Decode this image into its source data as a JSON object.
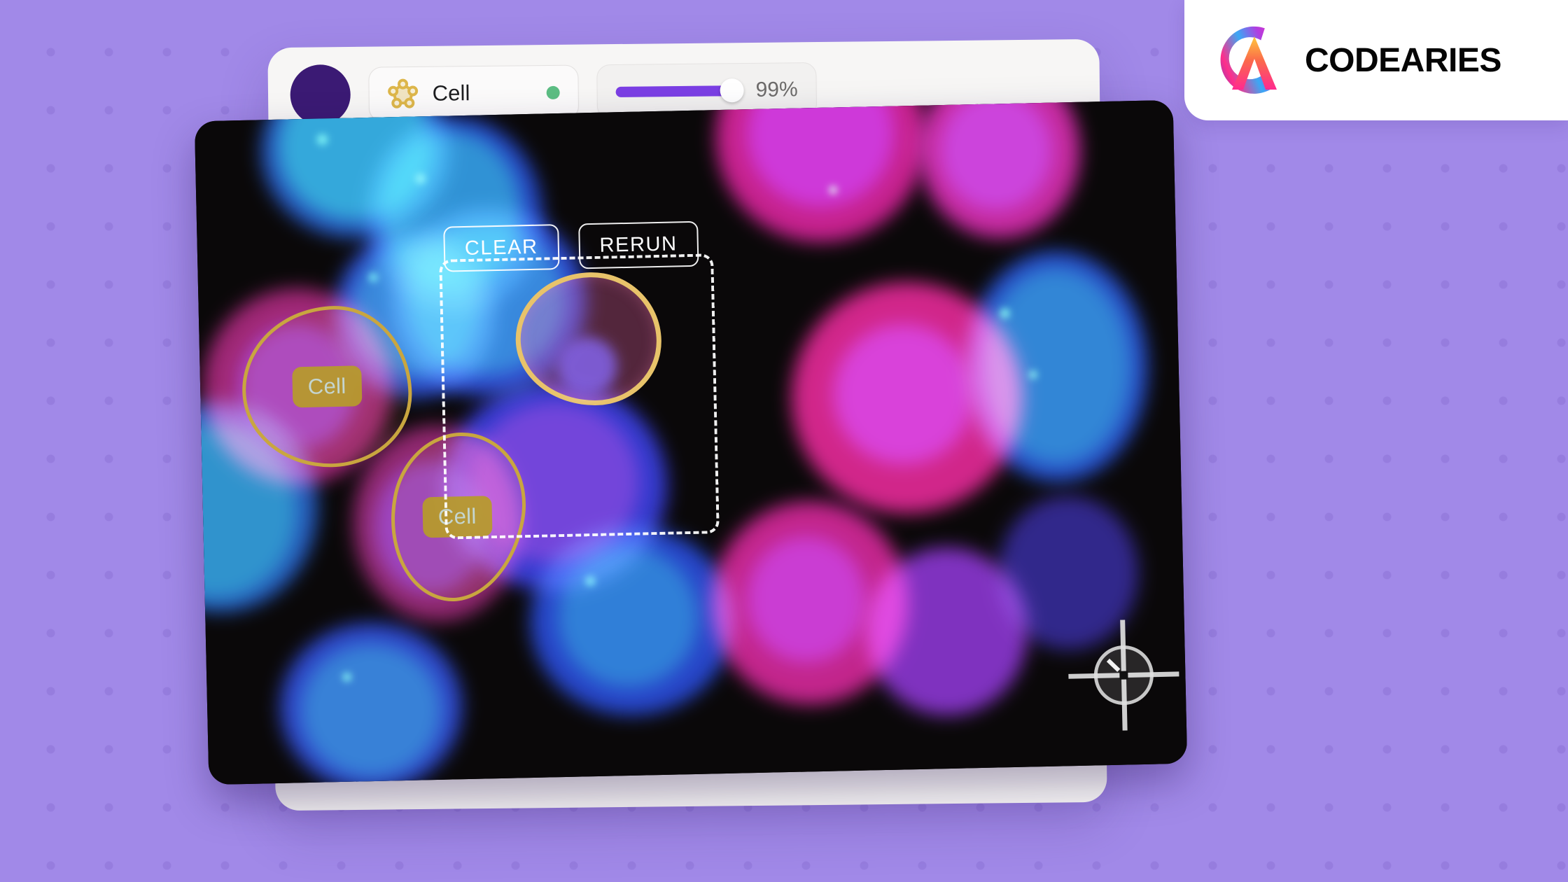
{
  "background": {
    "color": "#a189e8",
    "dot_color": "#7d5fc8"
  },
  "toolbar": {
    "avatar": {
      "icon": "avatar-circle",
      "color": "#3b1a74"
    },
    "class_chip": {
      "icon": "polygon-node-icon",
      "icon_color": "#ddb64a",
      "label": "Cell",
      "status": {
        "icon": "status-dot-icon",
        "color": "#5cbd83",
        "state": "active"
      }
    },
    "confidence": {
      "value_label": "99%",
      "value": 99,
      "min": 0,
      "max": 100,
      "fill_color": "#7b3fe4"
    }
  },
  "viewer": {
    "background_color": "#0a0809",
    "actions": [
      {
        "id": "clear",
        "label": "CLEAR"
      },
      {
        "id": "rerun",
        "label": "RERUN"
      }
    ],
    "selection_box": {
      "visible": true,
      "style": "dashed",
      "color": "#ffffff"
    },
    "cursor": {
      "icon": "crosshair-cursor-icon",
      "color": "#d8d8d8"
    },
    "segments": [
      {
        "id": "seg-1",
        "label": "Cell",
        "selected": false,
        "outline_color": "#c9a63f"
      },
      {
        "id": "seg-2",
        "label": "Cell",
        "selected": false,
        "outline_color": "#c9a63f"
      },
      {
        "id": "seg-3",
        "label": "",
        "selected": true,
        "outline_color": "#e8c36a"
      }
    ]
  },
  "brand": {
    "name": "CODEARIES",
    "logo_icon": "codearies-logo-icon"
  }
}
